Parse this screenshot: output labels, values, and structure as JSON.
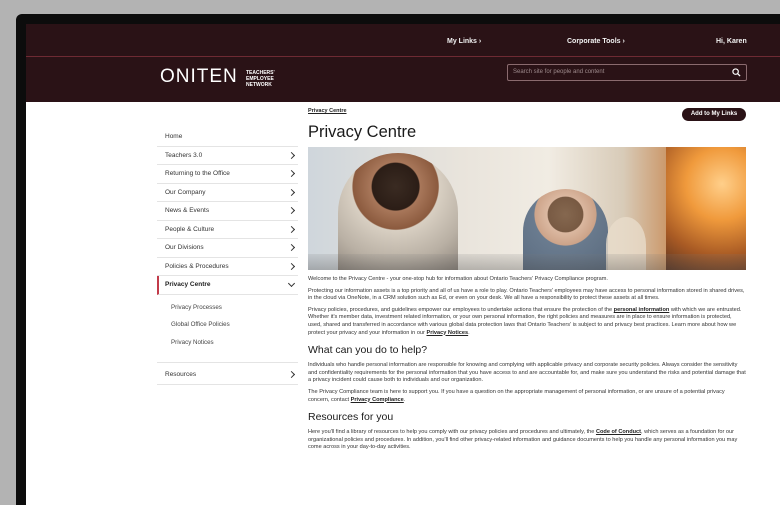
{
  "header": {
    "links": [
      "My Links",
      "Corporate Tools",
      "Hi, Karen"
    ],
    "logo_main": "ONITEN",
    "logo_small": "TEACHERS' EMPLOYEE NETWORK",
    "search_placeholder": "Search site for people and content"
  },
  "sidebar": {
    "items": [
      "Home",
      "Teachers 3.0",
      "Returning to the Office",
      "Our Company",
      "News & Events",
      "People & Culture",
      "Our Divisions",
      "Policies & Procedures",
      "Privacy Centre",
      "Resources"
    ],
    "sub_items": [
      "Privacy Processes",
      "Global Office Policies",
      "Privacy Notices"
    ]
  },
  "main": {
    "breadcrumb": "Privacy Centre",
    "add_button": "Add to My Links",
    "title": "Privacy Centre",
    "para1": "Welcome to the Privacy Centre - your one-stop hub for information about Ontario Teachers' Privacy Compliance program.",
    "para2": "Protecting our information assets is a top priority and all of us have a role to play. Ontario Teachers' employees may have access to personal information stored in shared drives, in the cloud via OneNote, in a CRM solution such as Ed, or even on your desk. We all have a responsibility to protect these assets at all times.",
    "para3a": "Privacy policies, procedures, and guidelines empower our employees to undertake actions that ensure the protection of the ",
    "para3_link1": "personal information",
    "para3b": " with which we are entrusted. Whether it's member data, investment related information, or your own personal information, the right policies and measures are in place to ensure information is protected, used, shared and transferred in accordance with various global data protection laws that Ontario Teachers' is subject to and privacy best practices. Learn more about how we protect your privacy and your information in our ",
    "para3_link2": "Privacy Notices",
    "para3c": ".",
    "h2a": "What can you do to help?",
    "para4": "Individuals who handle personal information are responsible for knowing and complying with applicable privacy and corporate security policies. Always consider the sensitivity and confidentiality requirements for the personal information that you have access to and are accountable for, and make sure you understand the risks and potential damage that a privacy incident could cause both to individuals and our organization.",
    "para5a": "The Privacy Compliance team is here to support you. If you have a question on the appropriate management of personal information, or are unsure of a potential privacy concern, contact ",
    "para5_link": "Privacy Compliance",
    "para5b": ".",
    "h2b": "Resources for you",
    "para6a": "Here you'll find a library of resources to help you comply with our privacy policies and procedures and ultimately, the ",
    "para6_link": "Code of Conduct",
    "para6b": ", which serves as a foundation for our organizational policies and procedures. In addition, you'll find other privacy-related information and guidance documents to help you handle any personal information you may come across in your day-to-day activities."
  }
}
